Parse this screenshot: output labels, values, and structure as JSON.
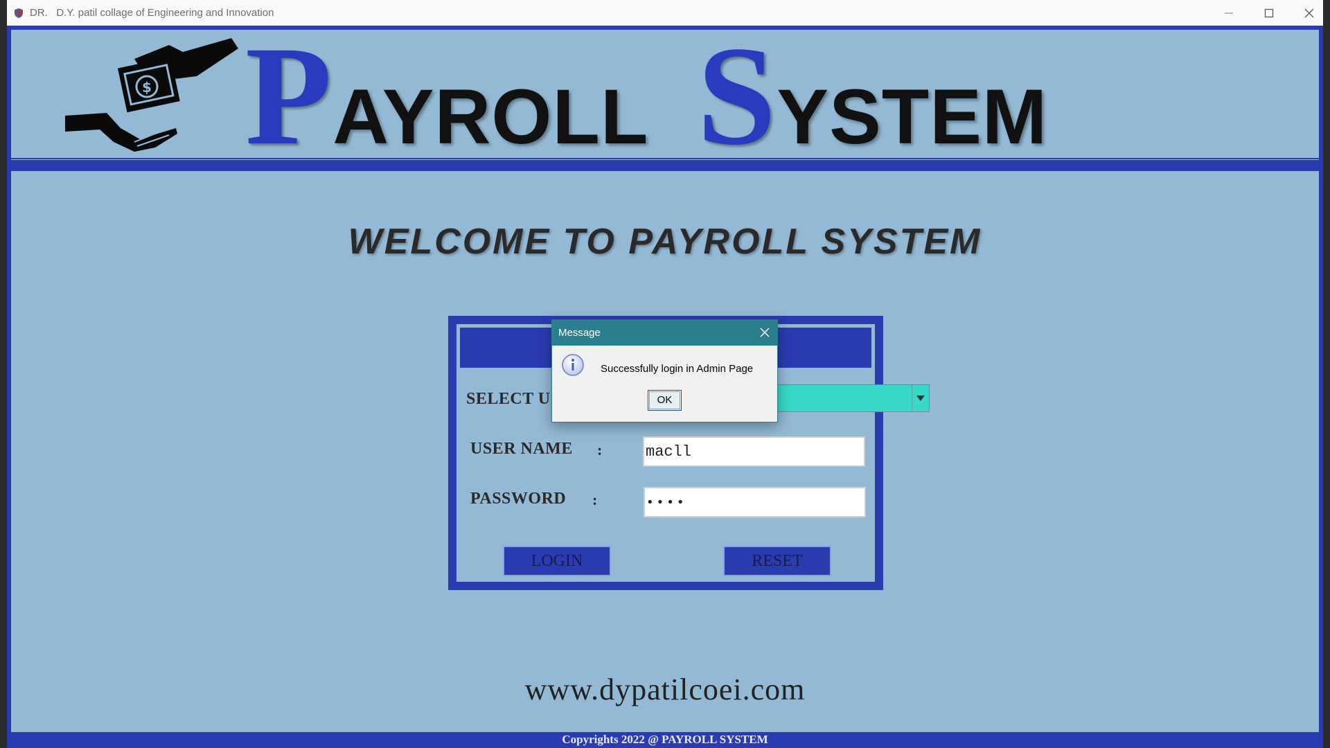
{
  "window": {
    "title": "DR.   D.Y. patil collage of Engineering and Innovation"
  },
  "header": {
    "logo_word1_cap": "P",
    "logo_word1_rest": "AYROLL",
    "logo_word2_cap": "S",
    "logo_word2_rest": "YSTEM"
  },
  "main": {
    "welcome": "WELCOME TO PAYROLL SYSTEM",
    "website": "www.dypatilcoei.com",
    "footer": "Copyrights 2022 @ PAYROLL SYSTEM"
  },
  "login": {
    "select_user_label": "SELECT U",
    "username_label": "USER NAME",
    "username_colon": ":",
    "password_label": "PASSWORD",
    "password_colon": ":",
    "username_value": "macll",
    "password_value": "••••",
    "login_button": "LOGIN",
    "reset_button": "RESET"
  },
  "dialog": {
    "title": "Message",
    "message": "Successfully login in Admin Page",
    "ok_label": "OK"
  },
  "colors": {
    "brand_blue": "#2b3bb0",
    "panel_bg": "#93b9d4",
    "combo_teal": "#3ad8c8",
    "dialog_titlebar": "#2c7f8f"
  },
  "icons": {
    "app": "shield-icon",
    "logo": "money-hands-icon",
    "dialog": "info-icon",
    "combo": "chevron-down-icon"
  }
}
